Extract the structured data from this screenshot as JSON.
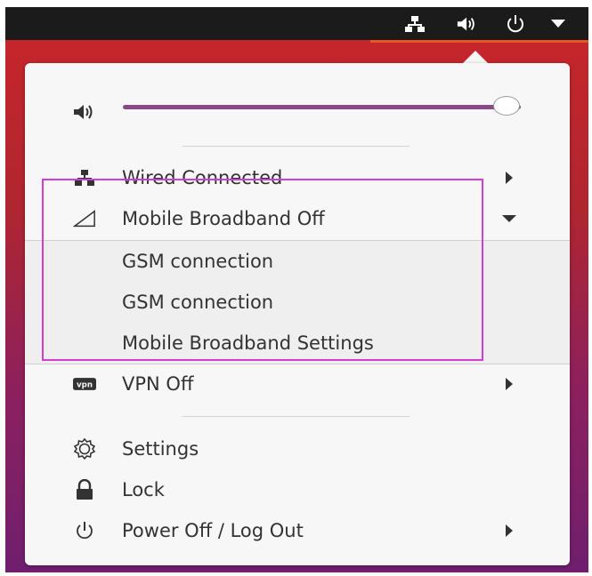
{
  "topbar": {
    "icons": [
      "network-wired-icon",
      "volume-icon",
      "power-icon",
      "dropdown-arrow-icon"
    ]
  },
  "menu": {
    "volume": {
      "icon": "volume-icon",
      "level": 1.0
    },
    "items": [
      {
        "label": "Wired Connected",
        "icon": "network-wired-icon",
        "has_submenu": true
      },
      {
        "label": "Mobile Broadband Off",
        "icon": "mobile-signal-icon",
        "expanded": true
      },
      {
        "label": "VPN Off",
        "icon": "vpn-icon",
        "has_submenu": true
      },
      {
        "label": "Settings",
        "icon": "gear-icon"
      },
      {
        "label": "Lock",
        "icon": "lock-icon"
      },
      {
        "label": "Power Off / Log Out",
        "icon": "power-icon",
        "has_submenu": true
      }
    ],
    "submenu": [
      {
        "label": "GSM connection"
      },
      {
        "label": "GSM connection"
      },
      {
        "label": "Mobile Broadband Settings"
      }
    ]
  },
  "colors": {
    "accent": "#e95420",
    "slider": "#8a4a87",
    "highlight": "#d63bd6",
    "panel": "#1b1b1b"
  }
}
